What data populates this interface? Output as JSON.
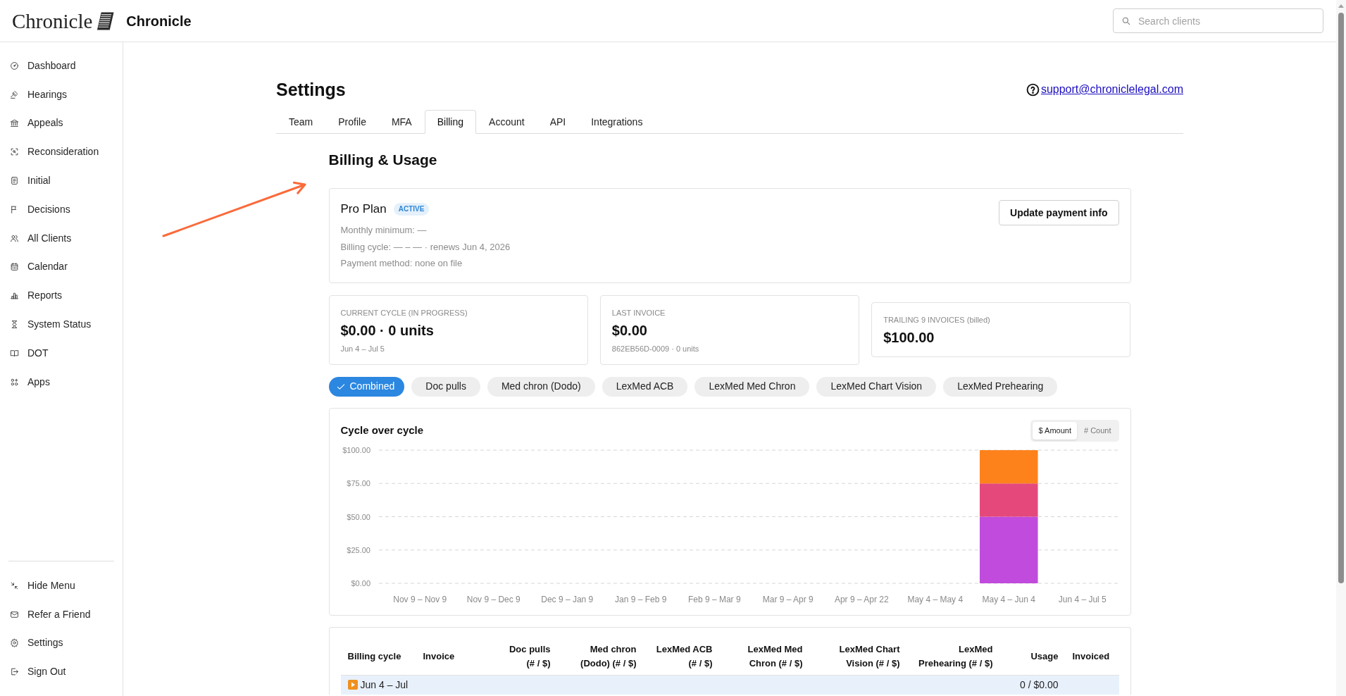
{
  "header": {
    "logo_text": "Chronicle",
    "app_name": "Chronicle",
    "search": {
      "placeholder": "Search clients"
    }
  },
  "sidebar": {
    "items": [
      "Dashboard",
      "Hearings",
      "Appeals",
      "Reconsideration",
      "Initial",
      "Decisions",
      "All Clients",
      "Calendar",
      "Reports",
      "System Status",
      "DOT",
      "Apps"
    ],
    "footer_items": [
      "Hide Menu",
      "Refer a Friend",
      "Settings",
      "Sign Out"
    ]
  },
  "page": {
    "title": "Settings",
    "support_email": "support@chroniclelegal.com",
    "tabs": [
      {
        "label": "Team",
        "selected": false
      },
      {
        "label": "Profile",
        "selected": false
      },
      {
        "label": "MFA",
        "selected": false
      },
      {
        "label": "Billing",
        "selected": true
      },
      {
        "label": "Account",
        "selected": false
      },
      {
        "label": "API",
        "selected": false
      },
      {
        "label": "Integrations",
        "selected": false
      }
    ]
  },
  "billing": {
    "title": "Billing & Usage",
    "plan": {
      "name": "Pro Plan",
      "status": "ACTIVE",
      "details": [
        "Monthly minimum: —",
        "Billing cycle: — – — · renews Jun 4, 2026",
        "Payment method: none on file"
      ],
      "button": "Update payment info"
    },
    "stats": [
      {
        "label": "CURRENT CYCLE (IN PROGRESS)",
        "value": "$0.00 · 0 units",
        "sub": "Jun 4 – Jul 5"
      },
      {
        "label": "LAST INVOICE",
        "value": "$0.00",
        "sub": "862EB56D-0009 · 0 units"
      },
      {
        "label": "TRAILING 9 INVOICES (billed)",
        "value": "$100.00"
      }
    ],
    "filters": [
      {
        "label": "Combined",
        "selected": true
      },
      {
        "label": "Doc pulls",
        "selected": false
      },
      {
        "label": "Med chron (Dodo)",
        "selected": false
      },
      {
        "label": "LexMed ACB",
        "selected": false
      },
      {
        "label": "LexMed Med Chron",
        "selected": false
      },
      {
        "label": "LexMed Chart Vision",
        "selected": false
      },
      {
        "label": "LexMed Prehearing",
        "selected": false
      }
    ],
    "chart": {
      "title": "Cycle over cycle",
      "toggle": [
        {
          "label": "$ Amount",
          "selected": true
        },
        {
          "label": "# Count",
          "selected": false
        }
      ],
      "chart_data": {
        "type": "bar",
        "stacked": true,
        "grid": true,
        "categories": [
          "Nov 9 – Nov 9",
          "Nov 9 – Dec 9",
          "Dec 9 – Jan 9",
          "Jan 9 – Feb 9",
          "Feb 9 – Mar 9",
          "Mar 9 – Apr 9",
          "Apr 9 – Apr 22",
          "May 4 – May 4",
          "May 4 – Jun 4",
          "Jun 4 – Jul 5"
        ],
        "series": [
          {
            "color": "#c04bdd",
            "values": [
              0,
              0,
              0,
              0,
              0,
              0,
              0,
              0,
              50,
              0
            ]
          },
          {
            "color": "#e5497b",
            "values": [
              0,
              0,
              0,
              0,
              0,
              0,
              0,
              0,
              25,
              0
            ]
          },
          {
            "color": "#fd821c",
            "values": [
              0,
              0,
              0,
              0,
              0,
              0,
              0,
              0,
              25,
              0
            ]
          }
        ],
        "ylim": [
          0,
          100
        ],
        "yticks": [
          {
            "value": 0,
            "label": "$0.00"
          },
          {
            "value": 25,
            "label": "$25.00"
          },
          {
            "value": 50,
            "label": "$50.00"
          },
          {
            "value": 75,
            "label": "$75.00"
          },
          {
            "value": 100,
            "label": "$100.00"
          }
        ]
      }
    }
  },
  "table": {
    "columns": [
      "Billing cycle",
      "Invoice",
      "Doc pulls (# / $)",
      "Med chron (Dodo) (# / $)",
      "LexMed ACB (# / $)",
      "LexMed Med Chron (# / $)",
      "LexMed Chart Vision (# / $)",
      "LexMed Prehearing (# / $)",
      "Usage",
      "Invoiced"
    ],
    "rows": [
      {
        "current": true,
        "billing_cycle": "Jun 4 – Jul",
        "usage": "0 / $0.00"
      }
    ]
  }
}
